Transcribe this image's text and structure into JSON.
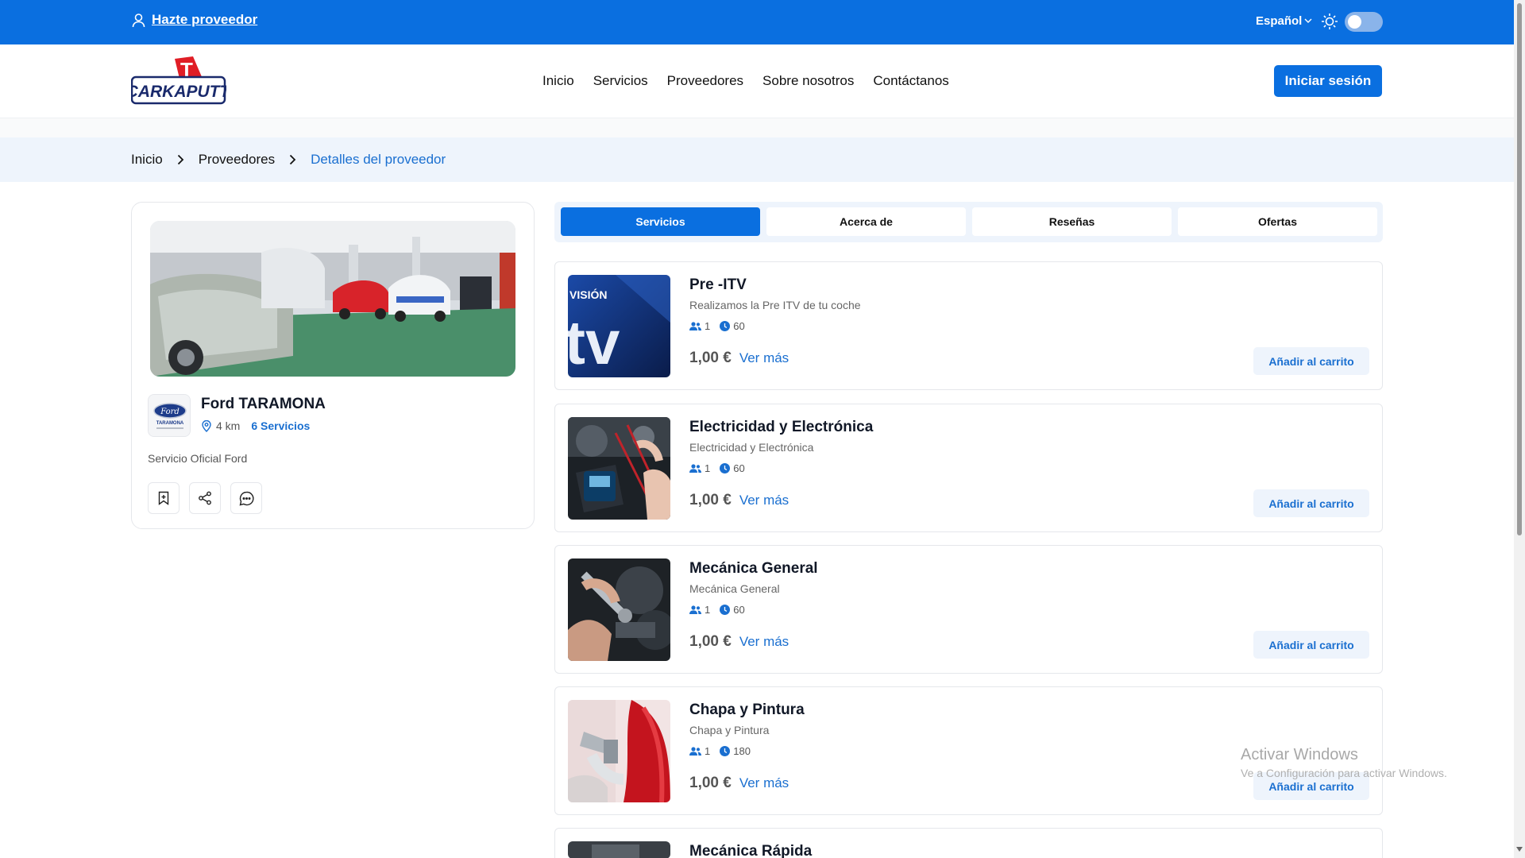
{
  "topbar": {
    "become_provider": "Hazte proveedor",
    "language": "Español"
  },
  "header": {
    "logo_text": "CARKAPUTT",
    "logo_letter": "T",
    "nav": [
      "Inicio",
      "Servicios",
      "Proveedores",
      "Sobre nosotros",
      "Contáctanos"
    ],
    "login": "Iniciar sesión"
  },
  "breadcrumb": [
    "Inicio",
    "Proveedores",
    "Detalles del proveedor"
  ],
  "provider": {
    "name": "Ford TARAMONA",
    "distance": "4 km",
    "services_count": "6 Servicios",
    "description": "Servicio Oficial Ford",
    "logo_brand": "Ford",
    "logo_caption": "TARAMONA"
  },
  "tabs": [
    "Servicios",
    "Acerca de",
    "Reseñas",
    "Ofertas"
  ],
  "services": [
    {
      "title": "Pre -ITV",
      "subtitle": "Realizamos la Pre ITV de tu coche",
      "people": "1",
      "minutes": "60",
      "price": "1,00 €",
      "more": "Ver más",
      "cart": "Añadir al carrito",
      "thumb_text": "VISIÓN",
      "thumb_big": "tv"
    },
    {
      "title": "Electricidad y Electrónica",
      "subtitle": "Electricidad y Electrónica",
      "people": "1",
      "minutes": "60",
      "price": "1,00 €",
      "more": "Ver más",
      "cart": "Añadir al carrito"
    },
    {
      "title": "Mecánica General",
      "subtitle": "Mecánica General",
      "people": "1",
      "minutes": "60",
      "price": "1,00 €",
      "more": "Ver más",
      "cart": "Añadir al carrito"
    },
    {
      "title": "Chapa y Pintura",
      "subtitle": "Chapa y Pintura",
      "people": "1",
      "minutes": "180",
      "price": "1,00 €",
      "more": "Ver más",
      "cart": "Añadir al carrito"
    },
    {
      "title": "Mecánica Rápida"
    }
  ],
  "watermark": {
    "title": "Activar Windows",
    "subtitle": "Ve a Configuración para activar Windows."
  },
  "colors": {
    "primary": "#0a6fe0",
    "link": "#1a6fd0",
    "breadcrumb_bg": "#eef4fc"
  }
}
